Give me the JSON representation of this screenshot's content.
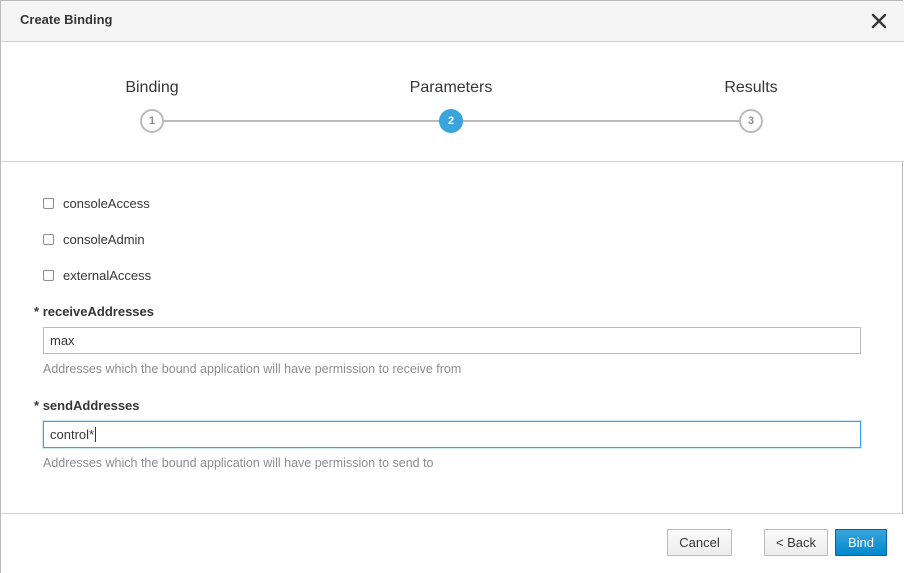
{
  "dialog": {
    "title": "Create Binding"
  },
  "wizard": {
    "steps": [
      {
        "label": "Binding",
        "number": "1",
        "active": false
      },
      {
        "label": "Parameters",
        "number": "2",
        "active": true
      },
      {
        "label": "Results",
        "number": "3",
        "active": false
      }
    ]
  },
  "form": {
    "checkboxes": [
      {
        "label": "consoleAccess",
        "checked": false
      },
      {
        "label": "consoleAdmin",
        "checked": false
      },
      {
        "label": "externalAccess",
        "checked": false
      }
    ],
    "receive": {
      "required_marker": "*",
      "label": "receiveAddresses",
      "value": "max",
      "help": "Addresses which the bound application will have permission to receive from"
    },
    "send": {
      "required_marker": "*",
      "label": "sendAddresses",
      "value": "control*",
      "help": "Addresses which the bound application will have permission to send to"
    }
  },
  "footer": {
    "cancel_label": "Cancel",
    "back_label": "< Back",
    "bind_label": "Bind"
  },
  "colors": {
    "accent": "#39a5dc",
    "primary": "#0088ce",
    "muted_text": "#8b8d8f"
  }
}
